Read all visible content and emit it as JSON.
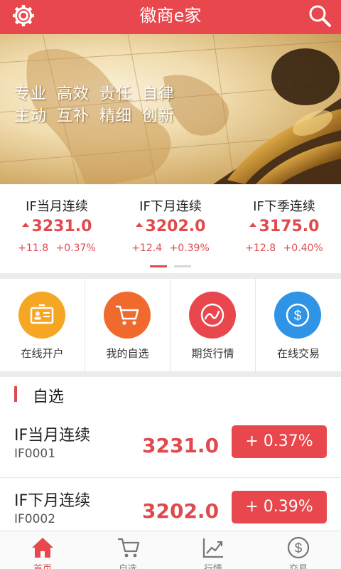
{
  "header": {
    "title": "徽商e家",
    "bg_color": "#e8474d",
    "left_icon": "gear-icon",
    "right_icon": "search-icon"
  },
  "banner": {
    "slogan_line1": "专业 高效 责任 自律",
    "slogan_line2": "主动 互补 精细 创新"
  },
  "ticker": {
    "items": [
      {
        "name": "IF当月连续",
        "price": "3231.0",
        "change": "+11.8",
        "percent": "+0.37%"
      },
      {
        "name": "IF下月连续",
        "price": "3202.0",
        "change": "+12.4",
        "percent": "+0.39%"
      },
      {
        "name": "IF下季连续",
        "price": "3175.0",
        "change": "+12.8",
        "percent": "+0.40%"
      }
    ],
    "up_color": "#e04a4f"
  },
  "quick_actions": [
    {
      "label": "在线开户",
      "icon": "id-card-icon",
      "color": "#f5a623"
    },
    {
      "label": "我的自选",
      "icon": "cart-icon",
      "color": "#f06a2e"
    },
    {
      "label": "期货行情",
      "icon": "trend-icon",
      "color": "#e8474d"
    },
    {
      "label": "在线交易",
      "icon": "dollar-icon",
      "color": "#2f93e6"
    }
  ],
  "watchlist": {
    "title": "自选",
    "rows": [
      {
        "name": "IF当月连续",
        "code": "IF0001",
        "price": "3231.0",
        "change": "+ 0.37%"
      },
      {
        "name": "IF下月连续",
        "code": "IF0002",
        "price": "3202.0",
        "change": "+ 0.39%"
      }
    ]
  },
  "bottom_nav": [
    {
      "label": "首页",
      "icon": "home-icon",
      "active": true
    },
    {
      "label": "自选",
      "icon": "cart-icon",
      "active": false
    },
    {
      "label": "行情",
      "icon": "chart-icon",
      "active": false
    },
    {
      "label": "交易",
      "icon": "dollar-icon",
      "active": false
    }
  ],
  "colors": {
    "accent": "#e8474d",
    "price_up": "#e04a4f",
    "nav_active": "#e04a4f"
  }
}
